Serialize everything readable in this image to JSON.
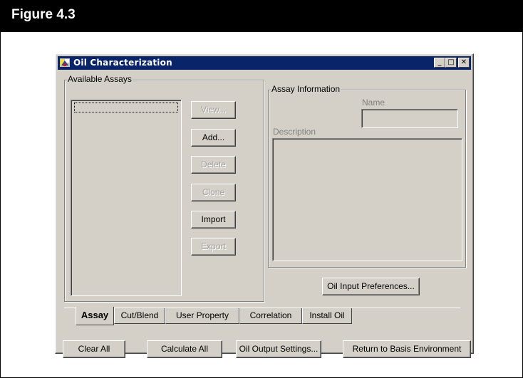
{
  "figure_label": "Figure 4.3",
  "window": {
    "title": "Oil Characterization",
    "controls": {
      "minimize": "_",
      "maximize": "□",
      "close": "✕"
    }
  },
  "available_assays": {
    "group_label": "Available Assays",
    "buttons": [
      {
        "label": "View...",
        "enabled": false
      },
      {
        "label": "Add...",
        "enabled": true
      },
      {
        "label": "Delete",
        "enabled": false
      },
      {
        "label": "Clone",
        "enabled": false
      },
      {
        "label": "Import",
        "enabled": true
      },
      {
        "label": "Export",
        "enabled": false
      }
    ]
  },
  "assay_information": {
    "group_label": "Assay  Information",
    "name_label": "Name",
    "description_label": "Description",
    "name_value": "",
    "description_value": ""
  },
  "oil_input_preferences_label": "Oil Input Preferences...",
  "tabs": [
    {
      "label": "Assay",
      "active": true
    },
    {
      "label": "Cut/Blend",
      "active": false
    },
    {
      "label": "User Property",
      "active": false
    },
    {
      "label": "Correlation",
      "active": false
    },
    {
      "label": "Install Oil",
      "active": false
    }
  ],
  "bottom_buttons": {
    "clear_all": "Clear All",
    "calculate_all": "Calculate All",
    "oil_output_settings": "Oil Output Settings...",
    "return_basis": "Return to Basis Environment"
  }
}
